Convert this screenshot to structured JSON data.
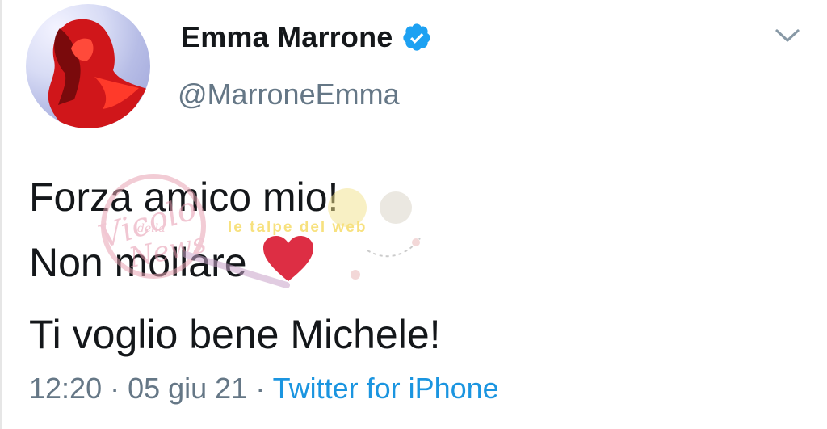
{
  "user": {
    "display_name": "Emma Marrone",
    "handle": "@MarroneEmma",
    "avatar_icon": "profile-photo",
    "verified_icon": "verified-badge-icon"
  },
  "tweet": {
    "lines": [
      "Forza amico mio!",
      "Non mollare",
      "Ti voglio bene Michele!"
    ],
    "emoji": "red-heart"
  },
  "meta": {
    "time": "12:20",
    "separator": " · ",
    "date": "05 giu 21",
    "source": "Twitter for iPhone"
  },
  "watermark": {
    "left_logo_top": "Vicolo",
    "left_logo_middle": "della",
    "left_logo_bottom": "News",
    "right_logo": "le talpe del web"
  },
  "colors": {
    "text": "#14171a",
    "secondary": "#657786",
    "link": "#1b95e0",
    "verified": "#1da1f2",
    "heart": "#dd2e44"
  }
}
